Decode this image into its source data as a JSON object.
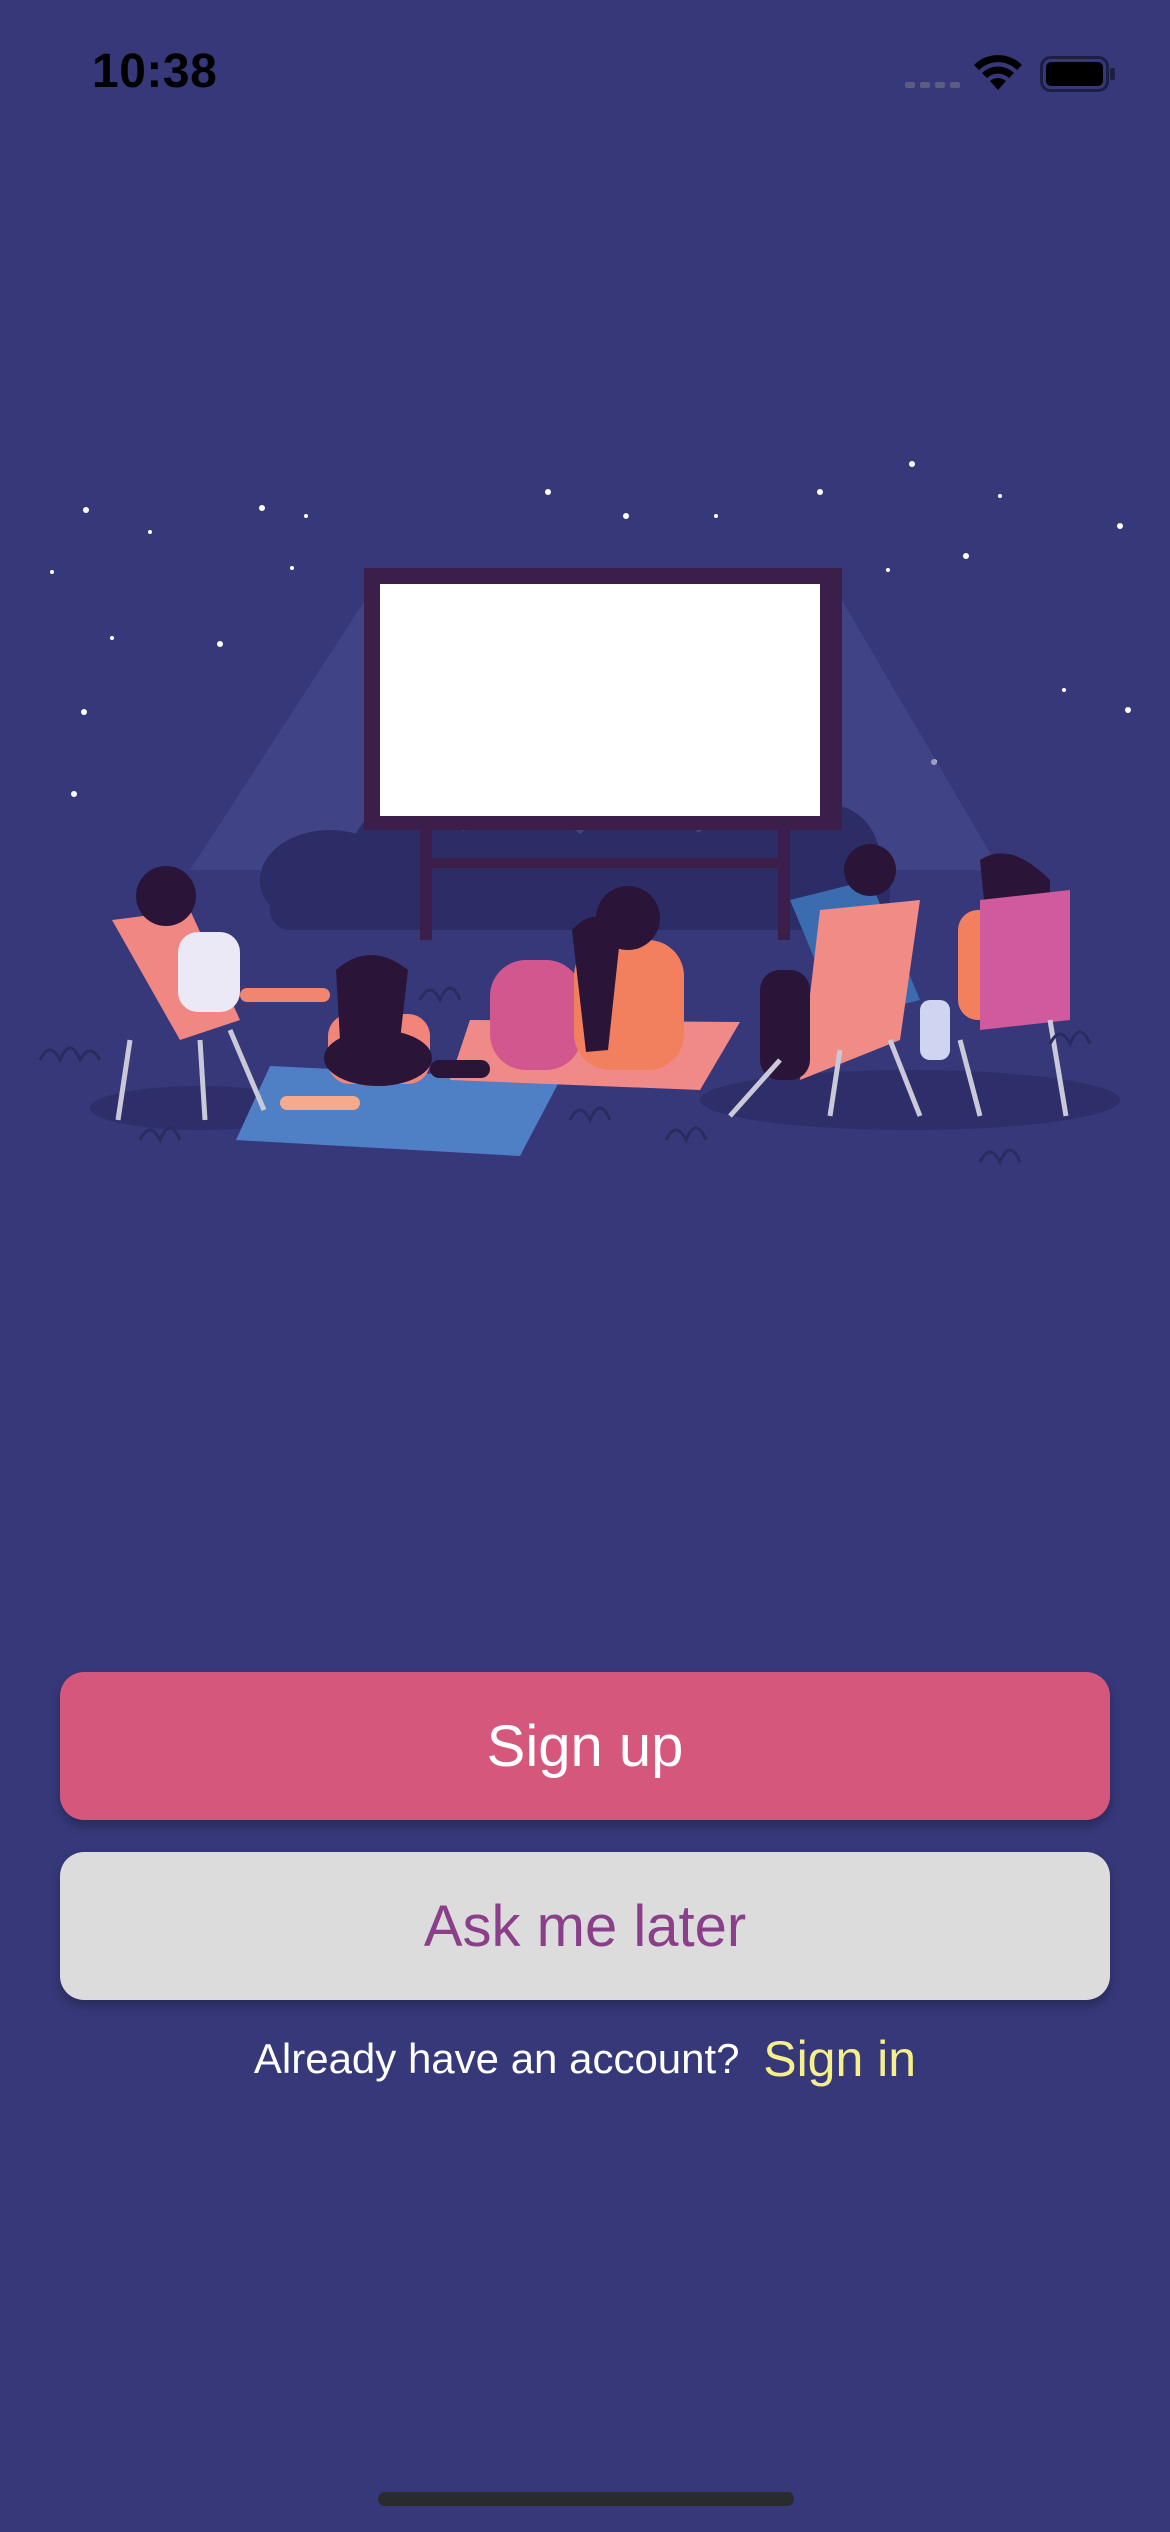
{
  "status_bar": {
    "time": "10:38"
  },
  "illustration": {
    "icon": "outdoor-cinema-illustration"
  },
  "actions": {
    "signup_label": "Sign up",
    "later_label": "Ask me later"
  },
  "footer": {
    "prompt": "Already have an account?",
    "signin_label": "Sign in"
  },
  "colors": {
    "background": "#36387a",
    "signup_button": "#d5577c",
    "later_button": "#dcdcdc",
    "later_text": "#8b3f8a",
    "signin_link": "#f5f08a"
  }
}
